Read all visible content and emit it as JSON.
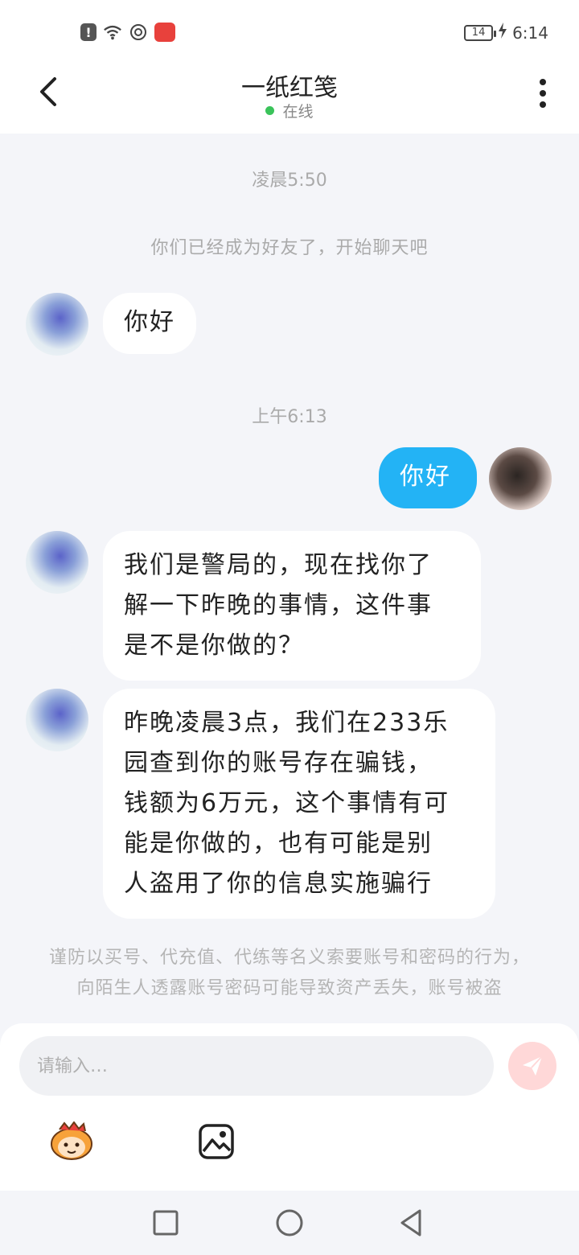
{
  "status_bar": {
    "battery": "14",
    "time": "6:14"
  },
  "header": {
    "title": "一纸红笺",
    "status": "在线"
  },
  "chat": {
    "ts1": "凌晨5:50",
    "system_message": "你们已经成为好友了，开始聊天吧",
    "msg1": "你好",
    "ts2": "上午6:13",
    "msg2": "你好",
    "msg3_lines": [
      "我们是警局的，现在找你了",
      "解一下昨晚的事情，这件事",
      "是不是你做的？"
    ],
    "msg4_lines": [
      "昨晚凌晨3点，我们在233乐",
      "园查到你的账号存在骗钱，",
      "钱额为6万元，这个事情有可",
      "能是你做的，也有可能是别",
      "人盗用了你的信息实施骗行"
    ],
    "warning": "谨防以买号、代充值、代练等名义索要账号和密码的行为，向陌生人透露账号密码可能导致资产丢失，账号被盗"
  },
  "input": {
    "placeholder": "请输入…",
    "value": ""
  },
  "colors": {
    "accent_blue": "#23b3f5",
    "online_green": "#3ac35a",
    "send_disabled": "#ffd8d8"
  },
  "icons": {
    "back": "chevron-left-icon",
    "more": "more-vertical-icon",
    "send": "send-icon",
    "emoji": "emoji-icon",
    "image": "image-icon"
  }
}
